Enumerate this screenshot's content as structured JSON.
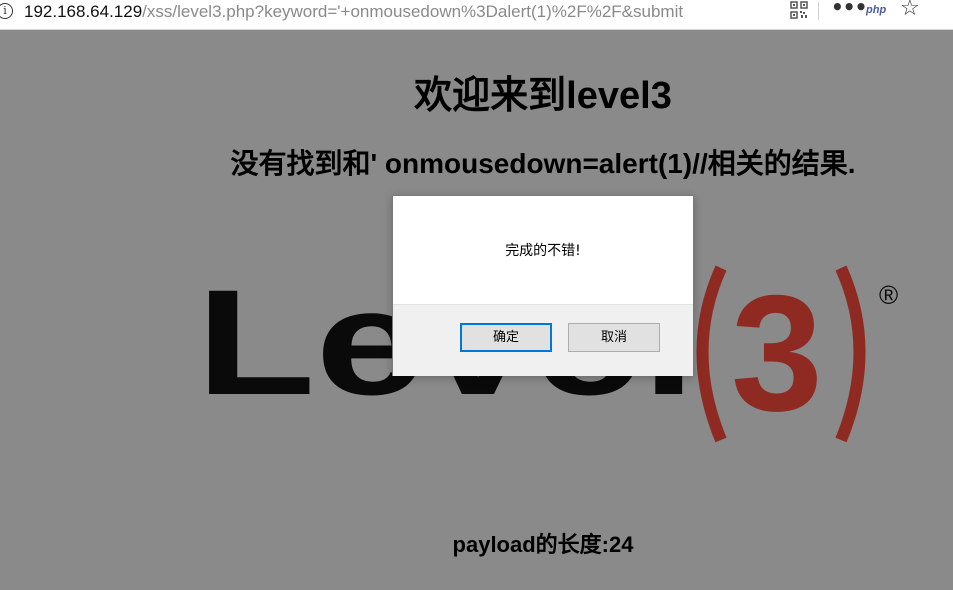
{
  "browser": {
    "url_host": "192.168.64.129",
    "url_path": "/xss/level3.php?keyword='+onmousedown%3Dalert(1)%2F%2F&submit",
    "info_icon_glyph": "i",
    "php_icon_label": "php",
    "icons": [
      "info-icon",
      "qr-code-icon",
      "more-icon",
      "php-icon",
      "star-icon"
    ]
  },
  "page": {
    "title": "欢迎来到level3",
    "result_message": "没有找到和' onmousedown=alert(1)//相关的结果.",
    "payload_length": "payload的长度:24",
    "logo": {
      "word": "Level",
      "number": "3",
      "registered_mark": "®",
      "word_color": "#0a0a0a",
      "accent_color": "#8e2a22"
    }
  },
  "dialog": {
    "message": "完成的不错!",
    "ok_label": "确定",
    "cancel_label": "取消"
  },
  "colors": {
    "overlay_background": "#8a8a8a",
    "ok_button_focus": "#0078d7"
  }
}
